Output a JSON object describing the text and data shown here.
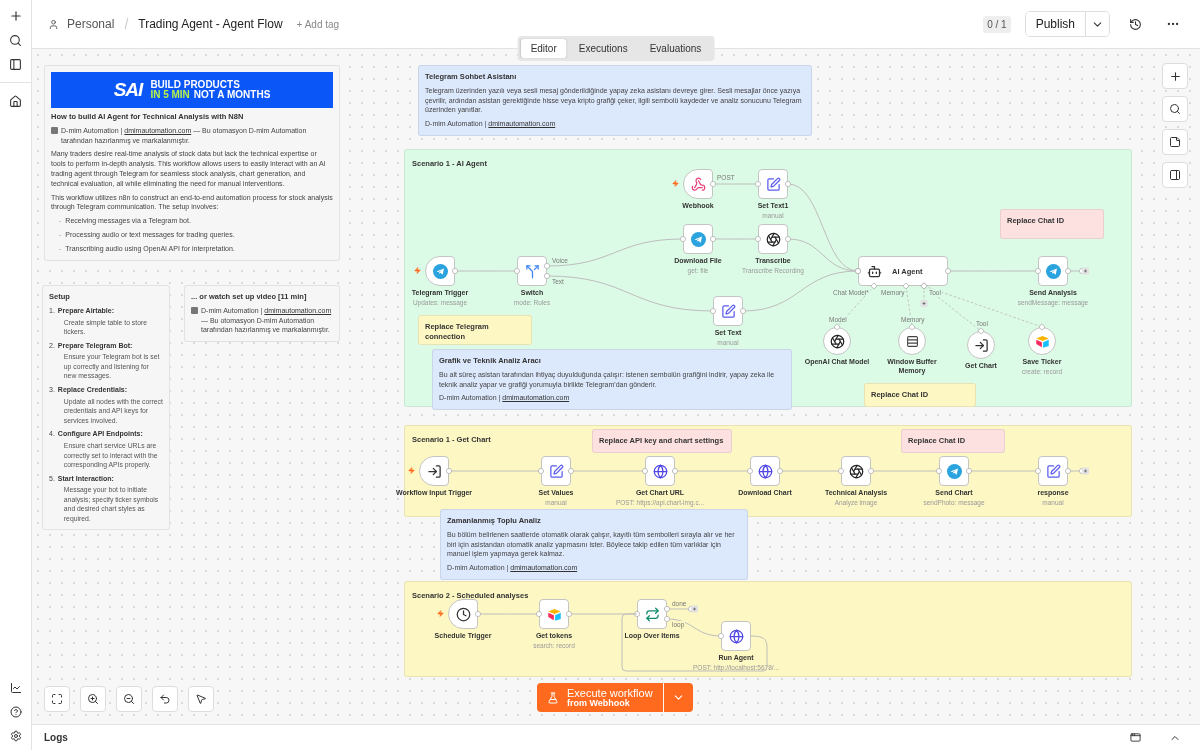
{
  "header": {
    "owner": "Personal",
    "separator": "/",
    "title": "Trading Agent - Agent Flow",
    "add_tag": "+ Add tag",
    "counter": "0 / 1",
    "publish": "Publish"
  },
  "view_tabs": [
    {
      "label": "Editor",
      "selected": true
    },
    {
      "label": "Executions",
      "selected": false
    },
    {
      "label": "Evaluations",
      "selected": false
    }
  ],
  "notes": [
    {
      "kind": "intro",
      "color": "#f6f6f6",
      "banner": {
        "logo": "SAI",
        "line1": "BUILD PRODUCTS",
        "highlight": "IN 5 MIN",
        "rest": "NOT A MONTHS"
      },
      "title": "How to build AI Agent for Technical Analysis with N8N",
      "source": {
        "prefix": "D-mim Automation |",
        "link": "dmimautomation.com",
        "suffix": "— Bu otomasyon D-mim Automation tarafından hazırlanmış ve markalanmıştır."
      },
      "paragraphs": [
        "Many traders desire real-time analysis of stock data but lack the technical expertise or tools to perform in-depth analysis. This workflow allows users to easily interact with an AI trading agent through Telegram for seamless stock analysis, chart generation, and technical evaluation, all while eliminating the need for manual interventions.",
        "This workflow utilizes n8n to construct an end-to-end automation process for stock analysis through Telegram communication. The setup involves:"
      ],
      "bullets": [
        {
          "marker": "-",
          "text": "Receiving messages via a Telegram bot."
        },
        {
          "marker": "-",
          "text": "Processing audio or text messages for trading queries."
        },
        {
          "marker": "-",
          "text": "Transcribing audio using OpenAI API for interpretation."
        }
      ]
    },
    {
      "kind": "steps",
      "color": "#f6f6f6",
      "title": "Setup",
      "steps": [
        {
          "number": "1.",
          "title": "Prepare Airtable:",
          "detail": "Create simple table to store tickers."
        },
        {
          "number": "2.",
          "title": "Prepare Telegram Bot:",
          "detail": "Ensure your Telegram bot is set up correctly and listening for new messages."
        },
        {
          "number": "3.",
          "title": "Replace Credentials:",
          "detail": "Update all nodes with the correct credentials and API keys for services involved."
        },
        {
          "number": "4.",
          "title": "Configure API Endpoints:",
          "detail": "Ensure chart service URLs are correctly set to interact with the corresponding APIs properly."
        },
        {
          "number": "5.",
          "title": "Start Interaction:",
          "detail": "Message your bot to initiate analysis; specify ticker symbols and desired chart styles as required."
        }
      ]
    },
    {
      "kind": "video",
      "color": "#f6f6f6",
      "title": "... or watch set up video [11 min]",
      "source": {
        "prefix": "D-mim Automation |",
        "link": "dmimautomation.com",
        "suffix": "— Bu otomasyon D-mim Automation tarafından hazırlanmış ve markalanmıştır."
      }
    },
    {
      "kind": "note",
      "color": "#dce8fc",
      "title": "Telegram Sohbet Asistanı",
      "text": "Telegram üzerinden yazılı veya sesli mesaj gönderildiğinde yapay zeka asistanı devreye girer. Sesli mesajlar önce yazıya çevrilir, ardından asistan gerektiğinde hisse veya kripto grafiği çeker, ilgili sembolü kaydeder ve analiz sonucunu Telegram üzerinden yanıtlar.",
      "footer": "D-mim Automation |",
      "link": "dmimautomation.com"
    },
    {
      "kind": "group",
      "color": "#dcfbe6",
      "title": "Scenario 1 - AI Agent"
    },
    {
      "kind": "label",
      "color": "#fde1e1",
      "title": "Replace Chat ID"
    },
    {
      "kind": "label",
      "color": "#fdf7c3",
      "title": "Replace Telegram connection"
    },
    {
      "kind": "note",
      "color": "#dce8fc",
      "title": "Grafik ve Teknik Analiz Aracı",
      "text": "Bu alt süreç asistan tarafından ihtiyaç duyulduğunda çalışır: istenen sembolün grafiğini indirir, yapay zeka ile teknik analiz yapar ve grafiği yorumuyla birlikte Telegram'dan gönderir.",
      "footer": "D-mim Automation |",
      "link": "dmimautomation.com"
    },
    {
      "kind": "label",
      "color": "#fdf7c3",
      "title": "Replace Chat ID"
    },
    {
      "kind": "group",
      "color": "#fdf7c3",
      "title": "Scenario 1 - Get Chart"
    },
    {
      "kind": "label",
      "color": "#fde1e1",
      "title": "Replace API key and chart settings"
    },
    {
      "kind": "label",
      "color": "#fde1e1",
      "title": "Replace Chat ID"
    },
    {
      "kind": "note",
      "color": "#dce8fc",
      "title": "Zamanlanmış Toplu Analiz",
      "text": "Bu bölüm belirlenen saatlerde otomatik olarak çalışır, kayıtlı tüm sembolleri sırayla alır ve her biri için asistandan otomatik analiz yapmasını ister. Böylece takip edilen tüm varlıklar için manuel işlem yapmaya gerek kalmaz.",
      "footer": "D-mim Automation |",
      "link": "dmimautomation.com"
    },
    {
      "kind": "group",
      "color": "#fdf7c3",
      "title": "Scenario 2 - Scheduled analyses"
    }
  ],
  "nodes": [
    {
      "kind": "trigger",
      "label": "Webhook"
    },
    {
      "kind": "action",
      "label": "Set Text1",
      "subtitle": "manual"
    },
    {
      "kind": "trigger",
      "label": "Telegram Trigger",
      "subtitle": "Updates: message"
    },
    {
      "kind": "action",
      "label": "Switch",
      "subtitle": "mode: Rules"
    },
    {
      "kind": "action",
      "label": "Download File",
      "subtitle": "get: file"
    },
    {
      "kind": "action",
      "label": "Transcribe",
      "subtitle": "Transcribe Recording"
    },
    {
      "kind": "action",
      "label": "Set Text",
      "subtitle": "manual"
    },
    {
      "kind": "agent",
      "label": "AI Agent"
    },
    {
      "kind": "action",
      "label": "Send Analysis",
      "subtitle": "sendMessage: message"
    },
    {
      "kind": "tool",
      "label": "OpenAI Chat Model"
    },
    {
      "kind": "tool",
      "label": "Window Buffer Memory"
    },
    {
      "kind": "tool",
      "label": "Get Chart"
    },
    {
      "kind": "tool",
      "label": "Save Ticker",
      "subtitle": "create: record"
    },
    {
      "kind": "trigger",
      "label": "Workflow Input Trigger"
    },
    {
      "kind": "action",
      "label": "Set Values",
      "subtitle": "manual"
    },
    {
      "kind": "action",
      "label": "Get Chart URL",
      "subtitle": "POST: https://api.chart-img.c..."
    },
    {
      "kind": "action",
      "label": "Download Chart"
    },
    {
      "kind": "action",
      "label": "Technical Analysis",
      "subtitle": "Analyze image"
    },
    {
      "kind": "action",
      "label": "Send Chart",
      "subtitle": "sendPhoto: message"
    },
    {
      "kind": "action",
      "label": "response",
      "subtitle": "manual"
    },
    {
      "kind": "trigger",
      "label": "Schedule Trigger"
    },
    {
      "kind": "action",
      "label": "Get tokens",
      "subtitle": "search: record"
    },
    {
      "kind": "action",
      "label": "Loop Over Items"
    },
    {
      "kind": "action",
      "label": "Run Agent",
      "subtitle": "POST: http://localhost:5678/..."
    }
  ],
  "connection_labels": [
    "POST",
    "Voice",
    "Text",
    "Chat Model*",
    "Memory",
    "Tool",
    "Model",
    "Memory",
    "Tool",
    "done",
    "loop"
  ],
  "execute": {
    "label": "Execute workflow",
    "sub": "from Webhook"
  },
  "logs": {
    "label": "Logs"
  }
}
